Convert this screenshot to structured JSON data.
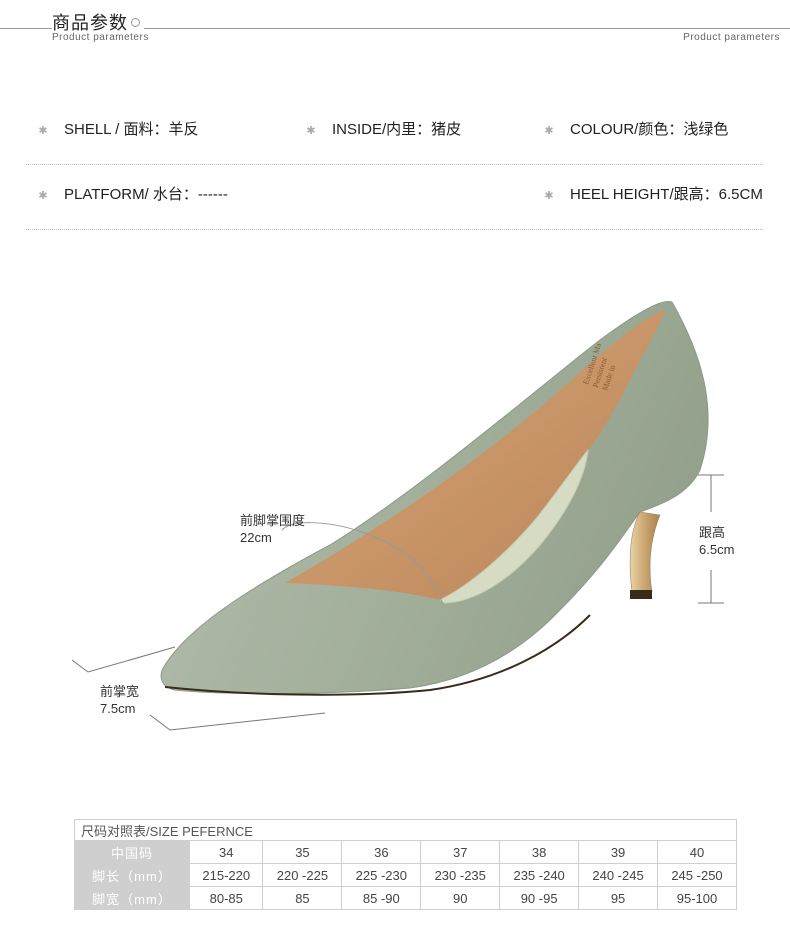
{
  "header": {
    "title": "商品参数",
    "subtitle_left": "Product parameters",
    "subtitle_right": "Product parameters"
  },
  "params": [
    {
      "label": "SHELL / 面料：羊反"
    },
    {
      "label": "INSIDE/内里：猪皮"
    },
    {
      "label": "COLOUR/颜色：浅绿色"
    },
    {
      "label": "PLATFORM/ 水台：------"
    },
    {
      "label": "HEEL HEIGHT/跟高：6.5CM"
    }
  ],
  "annotations": {
    "girth_label": "前脚掌围度",
    "girth_value": "22cm",
    "heel_label": "跟高",
    "heel_value": "6.5cm",
    "width_label": "前掌宽",
    "width_value": "7.5cm"
  },
  "insole_print": [
    "Excellent Ma",
    "Persistent",
    "Made in"
  ],
  "size_table": {
    "caption": "尺码对照表/SIZE PEFERNCE",
    "rows": [
      {
        "header": "中国码",
        "values": [
          "34",
          "35",
          "36",
          "37",
          "38",
          "39",
          "40"
        ]
      },
      {
        "header": "脚长（mm）",
        "values": [
          "215-220",
          "220 -225",
          "225 -230",
          "230 -235",
          "235 -240",
          "240 -245",
          "245 -250"
        ]
      },
      {
        "header": "脚宽（mm）",
        "values": [
          "80-85",
          "85",
          "85 -90",
          "90",
          "90 -95",
          "95",
          "95-100"
        ]
      }
    ]
  },
  "colors": {
    "suede": "#a6b3a0",
    "lining": "#c8956a",
    "table_header": "#cfcfcf"
  }
}
